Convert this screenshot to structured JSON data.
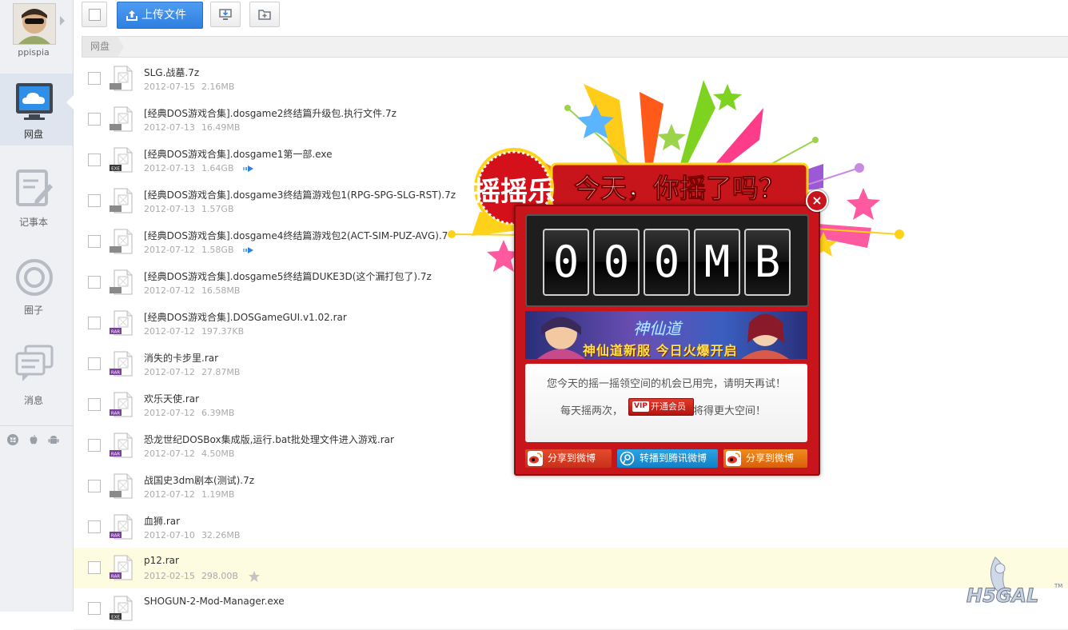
{
  "user": {
    "name": "ppispia"
  },
  "sidebar": {
    "items": [
      {
        "label": "网盘",
        "icon": "cloud-monitor-icon",
        "active": true
      },
      {
        "label": "记事本",
        "icon": "notepad-icon"
      },
      {
        "label": "圈子",
        "icon": "circle-icon"
      },
      {
        "label": "消息",
        "icon": "message-bubble-icon"
      }
    ],
    "platforms": [
      "windows-icon",
      "apple-icon",
      "android-icon"
    ]
  },
  "toolbar": {
    "upload_label": "上传文件"
  },
  "breadcrumb": {
    "root": "网盘"
  },
  "files": [
    {
      "name": "SLG.战墓.7z",
      "date": "2012-07-15",
      "size": "2.16MB",
      "type": "archive"
    },
    {
      "name": "[经典DOS游戏合集].dosgame2终结篇升级包.执行文件.7z",
      "date": "2012-07-13",
      "size": "16.49MB",
      "type": "archive"
    },
    {
      "name": "[经典DOS游戏合集].dosgame1第一部.exe",
      "date": "2012-07-13",
      "size": "1.64GB",
      "type": "exe",
      "extra": "transfer-arrow-icon"
    },
    {
      "name": "[经典DOS游戏合集].dosgame3终结篇游戏包1(RPG-SPG-SLG-RST).7z",
      "date": "2012-07-13",
      "size": "1.57GB",
      "type": "archive"
    },
    {
      "name": "[经典DOS游戏合集].dosgame4终结篇游戏包2(ACT-SIM-PUZ-AVG).7",
      "date": "2012-07-12",
      "size": "1.58GB",
      "type": "archive",
      "extra": "transfer-arrow-icon"
    },
    {
      "name": "[经典DOS游戏合集].dosgame5终结篇DUKE3D(这个漏打包了).7z",
      "date": "2012-07-12",
      "size": "16.58MB",
      "type": "archive"
    },
    {
      "name": "[经典DOS游戏合集].DOSGameGUI.v1.02.rar",
      "date": "2012-07-12",
      "size": "197.37KB",
      "type": "rar"
    },
    {
      "name": "消失的卡步里.rar",
      "date": "2012-07-12",
      "size": "27.87MB",
      "type": "rar"
    },
    {
      "name": "欢乐天使.rar",
      "date": "2012-07-12",
      "size": "6.39MB",
      "type": "rar"
    },
    {
      "name": "恐龙世纪DOSBox集成版,运行.bat批处理文件进入游戏.rar",
      "date": "2012-07-12",
      "size": "4.50MB",
      "type": "rar"
    },
    {
      "name": "战国史3dm剧本(测试).7z",
      "date": "2012-07-12",
      "size": "1.19MB",
      "type": "archive"
    },
    {
      "name": "血狮.rar",
      "date": "2012-07-10",
      "size": "32.26MB",
      "type": "rar"
    },
    {
      "name": "p12.rar",
      "date": "2012-02-15",
      "size": "298.00B",
      "type": "rar",
      "highlight": true,
      "extra": "star-icon"
    },
    {
      "name": "SHOGUN-2-Mod-Manager.exe",
      "date": "",
      "size": "",
      "type": "exe"
    }
  ],
  "popup": {
    "seal": "摇摇乐",
    "headline": "今天，你摇了吗？",
    "counter": [
      "0",
      "0",
      "0",
      "M",
      "B"
    ],
    "banner": {
      "logo": "神仙道",
      "tagline": "神仙道新服 今日火爆开启"
    },
    "message1": "您今天的摇一摇领空间的机会已用完，请明天再试！",
    "message2_prefix": "每天摇两次，",
    "vip_badge": "VIP",
    "vip_label": "开通会员",
    "message2_suffix": "将得更大空间！",
    "share": [
      {
        "label": "分享到微博",
        "icon": "weibo-icon",
        "color": "#d4361f"
      },
      {
        "label": "转播到腾讯微博",
        "icon": "tencent-weibo-icon",
        "color": "#1a8fd3"
      },
      {
        "label": "分享到微博",
        "icon": "weibo-icon",
        "color": "#e4760f"
      }
    ],
    "close": "×"
  },
  "watermark": {
    "text": "H5GAL",
    "tm": "TM"
  },
  "colors": {
    "accent_blue": "#2e7fe0",
    "popup_red": "#c8141b",
    "highlight_row": "#fdfbe0"
  }
}
